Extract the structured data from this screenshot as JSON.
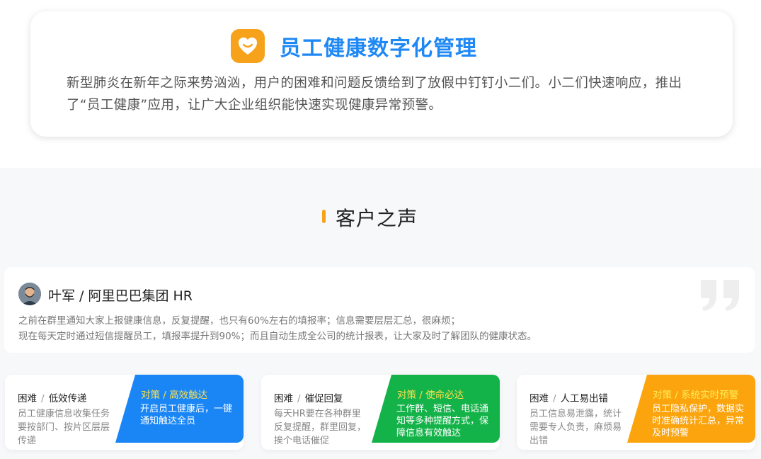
{
  "intro": {
    "icon": "smile-heart-icon",
    "title": "员工健康数字化管理",
    "description": "新型肺炎在新年之际来势汹汹，用户的困难和问题反馈给到了放假中钉钉小二们。小二们快速响应，推出了“员工健康”应用，让广大企业组织能快速实现健康异常预警。"
  },
  "voice": {
    "title": "客户之声",
    "testimonial": {
      "avatar": "user-avatar-icon",
      "name": "叶军 / 阿里巴巴集团 HR",
      "line1": "之前在群里通知大家上报健康信息，反复提醒，也只有60%左右的填报率；信息需要层层汇总，很麻烦；",
      "line2": "现在每天定时通过短信提醒员工，填报率提升到90%；而且自动生成全公司的统计报表，让大家及时了解团队的健康状态。",
      "quote_icon": "quote-mark-icon"
    },
    "cards": [
      {
        "problem_prefix": "困难",
        "separator": "/",
        "problem": "低效传递",
        "problem_desc": "员工健康信息收集任务要按部门、按片区层层传递",
        "solution_title": "对策 / 高效触达",
        "solution_desc": "开启员工健康后，一键通知触达全员",
        "color": "#1a86f5",
        "title_color": "#ffe04a"
      },
      {
        "problem_prefix": "困难",
        "separator": "/",
        "problem": "催促回复",
        "problem_desc": "每天HR要在各种群里反复提醒，群里回复，挨个电话催促",
        "solution_title": "对策 / 使命必达",
        "solution_desc": "工作群、短信、电话通知等多种提醒方式，保障信息有效触达",
        "color": "#14b34a",
        "title_color": "#ffe04a"
      },
      {
        "problem_prefix": "困难",
        "separator": "/",
        "problem": "人工易出错",
        "problem_desc": "员工信息易泄露，统计需要专人负责，麻烦易出错",
        "solution_title": "对策 / 系统实时预警",
        "solution_desc": "员工隐私保护，数据实时准确统计汇总，异常及时预警",
        "color": "#fba40e",
        "title_color": "#ffec55"
      }
    ]
  }
}
